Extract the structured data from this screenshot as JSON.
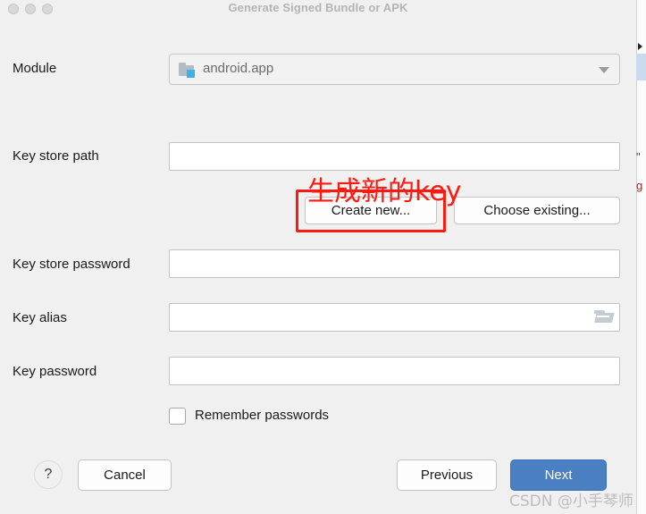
{
  "window": {
    "title": "Generate Signed Bundle or APK",
    "controls": [
      "close",
      "minimize",
      "zoom"
    ]
  },
  "form": {
    "module": {
      "label": "Module",
      "value": "android.app",
      "icon": "android-module-folder-icon",
      "dropdown_icon": "chevron-down-icon"
    },
    "key_store_path": {
      "label": "Key store path",
      "value": "",
      "placeholder": ""
    },
    "key_store_password": {
      "label": "Key store password",
      "value": "",
      "placeholder": ""
    },
    "key_alias": {
      "label": "Key alias",
      "value": "",
      "placeholder": "",
      "icon": "folder-open-icon"
    },
    "key_password": {
      "label": "Key password",
      "value": "",
      "placeholder": ""
    },
    "remember_passwords": {
      "label": "Remember passwords",
      "checked": false
    }
  },
  "keystore_actions": {
    "create_new": "Create new...",
    "choose_existing": "Choose existing..."
  },
  "footer": {
    "help": "?",
    "cancel": "Cancel",
    "previous": "Previous",
    "next": "Next"
  },
  "annotations": {
    "note_text": "生成新的key",
    "highlight_target": "Create new...",
    "color": "#fd1a10"
  },
  "watermark": {
    "text": "CSDN @小手琴师"
  },
  "colors": {
    "dialog_background": "#f0f0f0",
    "primary_button": "#4a7fc1",
    "title_text": "#b4b4b4",
    "annotation_red": "#fd1a10",
    "module_badge_blue": "#3bb3e0"
  },
  "background_sliver": {
    "line1": "\"",
    "line2": "g"
  }
}
